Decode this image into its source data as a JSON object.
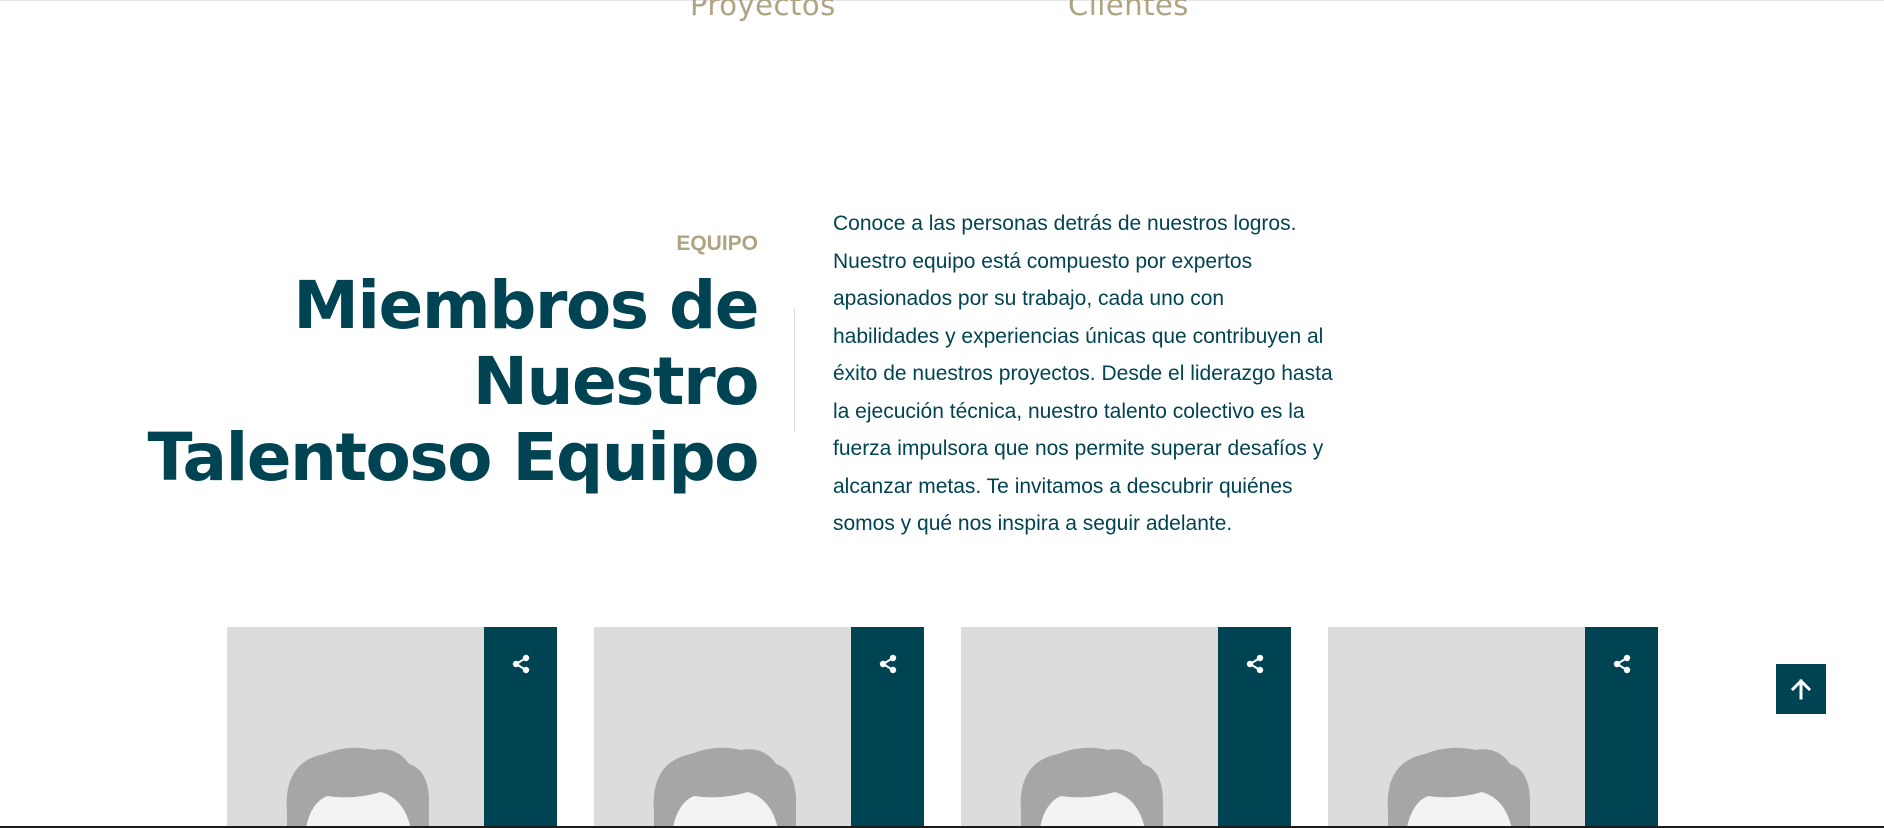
{
  "stats": {
    "proyectos_label": "Proyectos",
    "clientes_label": "Clientes"
  },
  "team_section": {
    "eyebrow": "EQUIPO",
    "title_lines": [
      "Miembros de",
      "Nuestro",
      "Talentoso Equipo"
    ],
    "description_lines": [
      "Conoce a las personas detrás de nuestros logros.",
      "Nuestro equipo está compuesto por expertos",
      "apasionados por su trabajo, cada uno con",
      "habilidades y experiencias únicas que contribuyen al",
      "éxito de nuestros proyectos. Desde el liderazgo hasta",
      "la ejecución técnica, nuestro talento colectivo es la",
      "fuerza impulsora que nos permite superar desafíos y",
      "alcanzar metas. Te invitamos a descubrir quiénes",
      "somos y qué nos inspira a seguir adelante."
    ]
  },
  "team_cards": [
    {
      "avatar_icon": "avatar-placeholder-icon",
      "share_icon": "share-icon"
    },
    {
      "avatar_icon": "avatar-placeholder-icon",
      "share_icon": "share-icon"
    },
    {
      "avatar_icon": "avatar-placeholder-icon",
      "share_icon": "share-icon"
    },
    {
      "avatar_icon": "avatar-placeholder-icon",
      "share_icon": "share-icon"
    }
  ],
  "scroll_top": {
    "icon": "arrow-up-icon"
  },
  "colors": {
    "primary": "#004352",
    "accent": "#b0a382",
    "card_bg": "#dcdcdc",
    "avatar_gray": "#a6a6a6"
  }
}
